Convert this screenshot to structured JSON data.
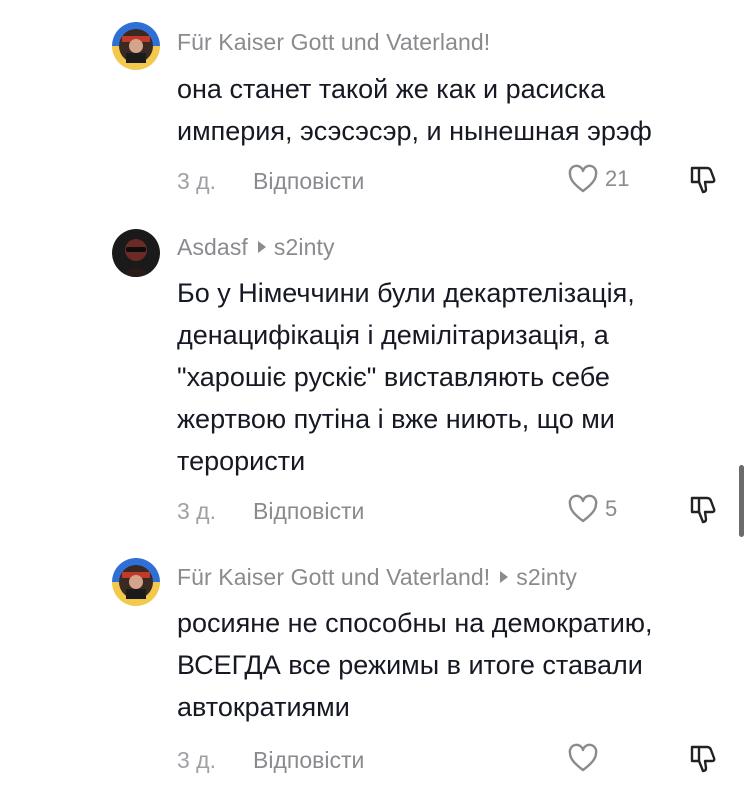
{
  "comments": [
    {
      "author": "Für Kaiser Gott und Vaterland!",
      "reply_to": "",
      "lines": [
        "она станет такой же как и расиска",
        "империя, эсэсэсэр, и нынешная эрэф"
      ],
      "time": "3 д.",
      "reply_label": "Відповісти",
      "likes": "21"
    },
    {
      "author": "Asdasf",
      "reply_to": "s2inty",
      "lines": [
        "Бо у Німеччини були декартелізація,",
        "денацифікація і демілітаризація, а",
        "\"харошіє рускіє\" виставляють себе",
        "жертвою путіна і вже ниють, що ми",
        "терористи"
      ],
      "time": "3 д.",
      "reply_label": "Відповісти",
      "likes": "5"
    },
    {
      "author": "Für Kaiser Gott und Vaterland!",
      "reply_to": "s2inty",
      "lines": [
        "росияне не способны на демократию,",
        "ВСЕГДА все режимы в итоге ставали",
        "автократиями"
      ],
      "time": "3 д.",
      "reply_label": "Відповісти",
      "likes": ""
    }
  ],
  "icons": {
    "like": "heart-outline-icon",
    "dislike": "thumbs-down-icon",
    "reply_indicator": "play-triangle-icon"
  },
  "colors": {
    "text": "#161823",
    "secondary": "#8a8a8f",
    "avatar_ring": "#f2c94c",
    "avatar_blue": "#2f6fd6"
  }
}
